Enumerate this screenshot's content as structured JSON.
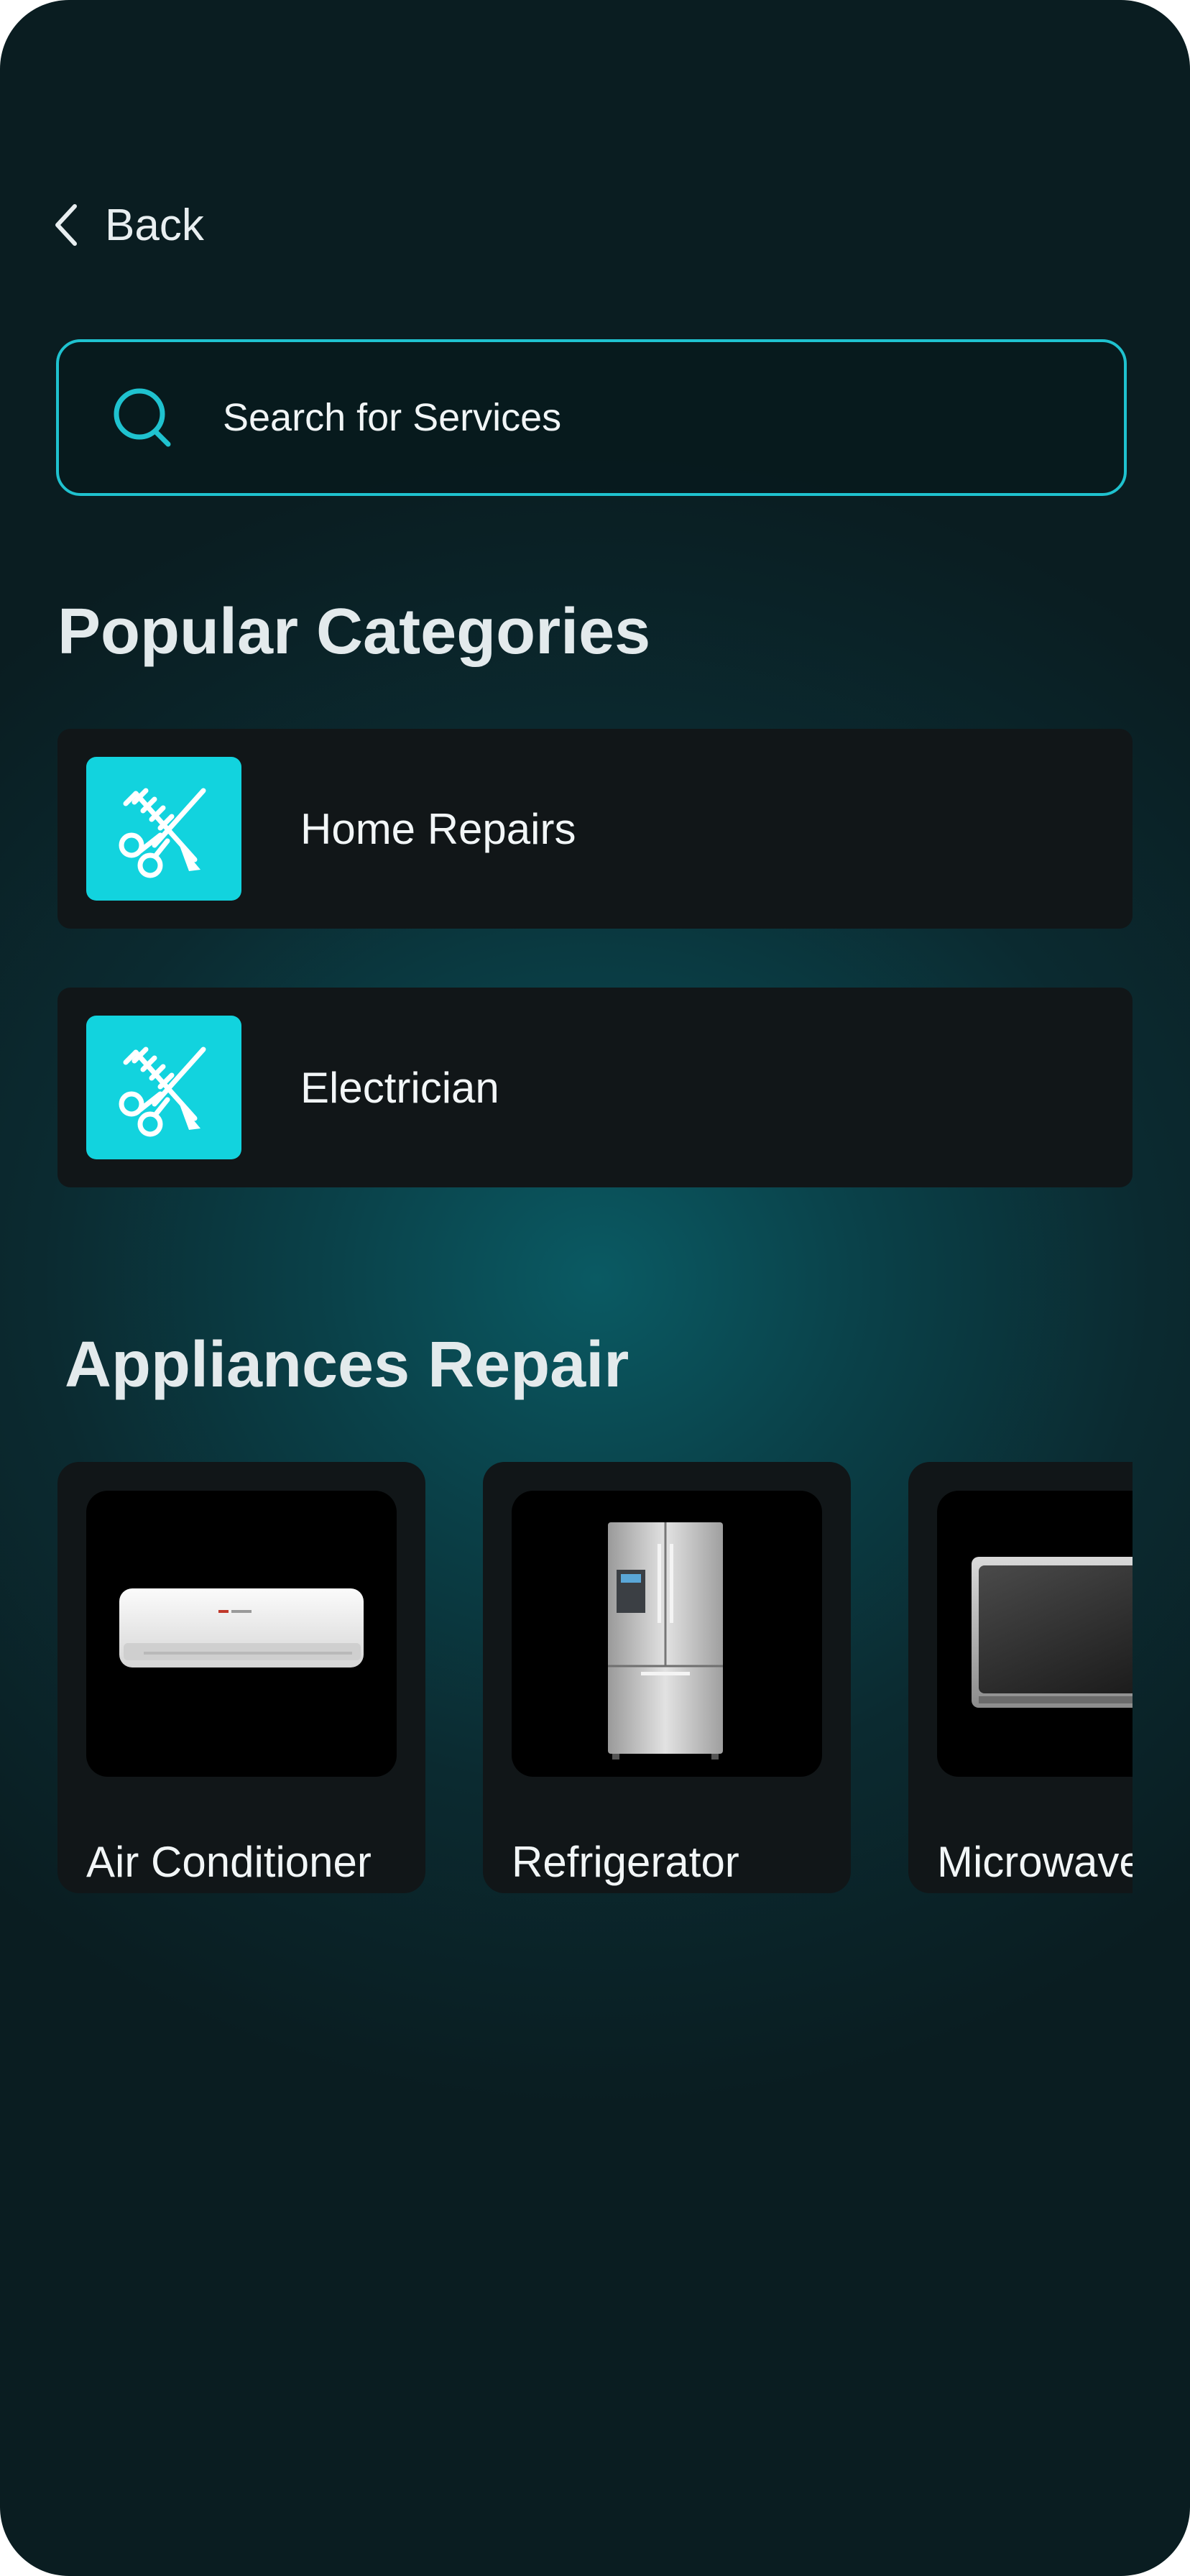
{
  "header": {
    "back_label": "Back"
  },
  "search": {
    "placeholder": "Search for Services"
  },
  "popular": {
    "title": "Popular Categories",
    "items": [
      {
        "label": "Home Repairs",
        "icon": "scissors-comb-icon"
      },
      {
        "label": "Electrician",
        "icon": "scissors-comb-icon"
      }
    ]
  },
  "appliances": {
    "title": "Appliances Repair",
    "items": [
      {
        "label": "Air Conditioner",
        "image": "air-conditioner-image"
      },
      {
        "label": "Refrigerator",
        "image": "refrigerator-image"
      },
      {
        "label": "Microwave",
        "image": "microwave-image"
      }
    ]
  },
  "colors": {
    "accent": "#12d3de",
    "search_border": "#1fc2cf",
    "card": "#111618",
    "text": "#f2f6f7"
  }
}
